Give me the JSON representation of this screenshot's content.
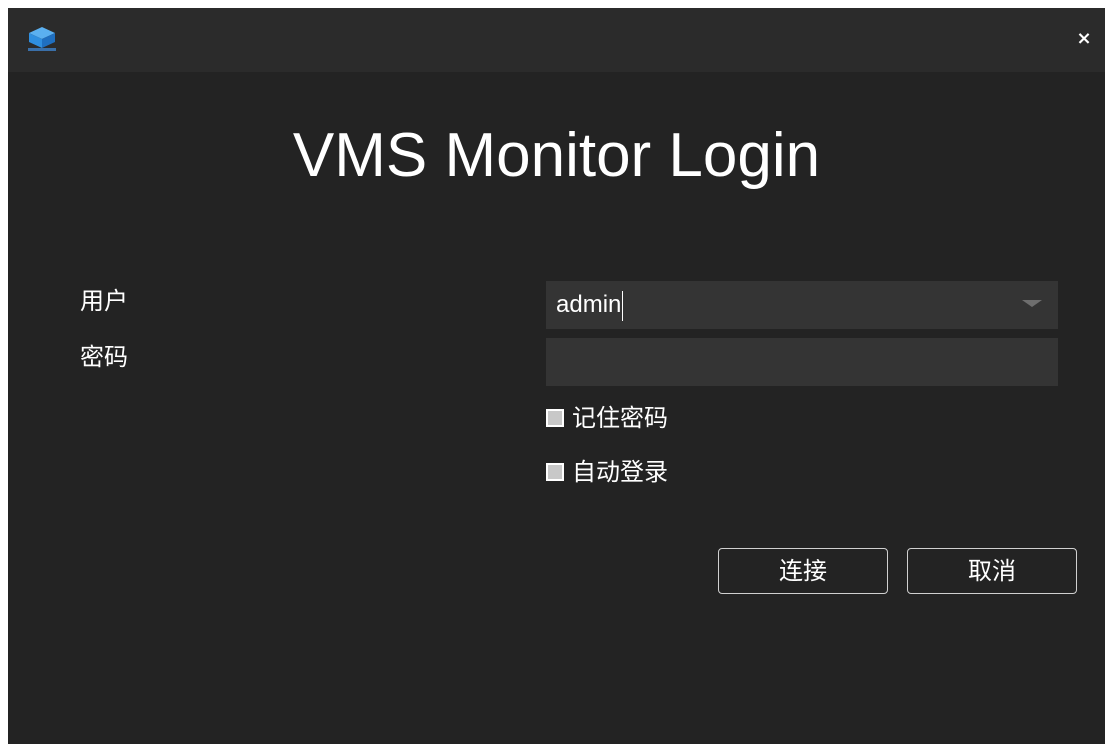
{
  "window": {
    "close_glyph": "×",
    "logo_icon": "cube-logo-icon"
  },
  "title": "VMS Monitor Login",
  "form": {
    "user_label": "用户",
    "user_value": "admin",
    "password_label": "密码",
    "password_value": "",
    "remember_label": "记住密码",
    "remember_checked": false,
    "auto_login_label": "自动登录",
    "auto_login_checked": false
  },
  "buttons": {
    "connect_label": "连接",
    "cancel_label": "取消"
  },
  "colors": {
    "background": "#232323",
    "titlebar": "#2b2b2b",
    "field": "#343434",
    "text": "#ffffff",
    "logo_blue": "#2f8fe0"
  }
}
